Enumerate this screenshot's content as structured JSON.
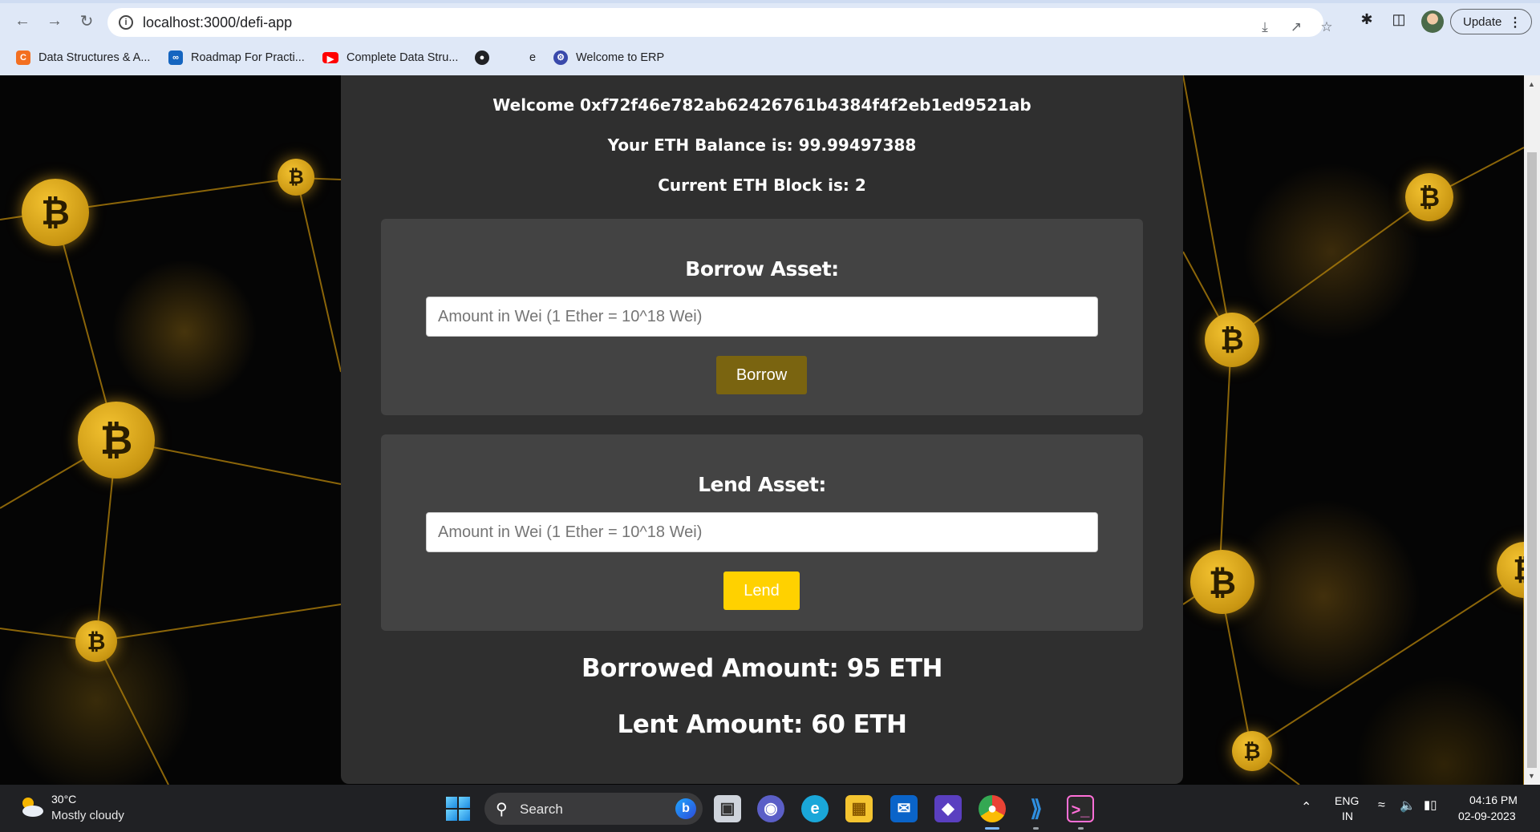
{
  "browser": {
    "url": "localhost:3000/defi-app",
    "update_label": "Update",
    "bookmarks": [
      {
        "label": "Data Structures & A...",
        "icon": "codechef-icon",
        "color": "#f36f21"
      },
      {
        "label": "Roadmap For Practi...",
        "icon": "infinity-icon",
        "color": "#1565c0"
      },
      {
        "label": "Complete Data Stru...",
        "icon": "youtube-icon",
        "color": "#ff0000"
      },
      {
        "label": "",
        "icon": "globe-icon",
        "color": "#202124"
      },
      {
        "label": "e",
        "icon": "",
        "color": ""
      },
      {
        "label": "Welcome to ERP",
        "icon": "erp-icon",
        "color": "#3949ab"
      }
    ]
  },
  "app": {
    "welcome": "Welcome 0xf72f46e782ab62426761b4384f4f2eb1ed9521ab",
    "balance": "Your ETH Balance is: 99.99497388",
    "block": "Current ETH Block is: 2",
    "borrow": {
      "title": "Borrow Asset:",
      "placeholder": "Amount in Wei (1 Ether = 10^18 Wei)",
      "button_label": "Borrow",
      "button_color": "#7a6410"
    },
    "lend": {
      "title": "Lend Asset:",
      "placeholder": "Amount in Wei (1 Ether = 10^18 Wei)",
      "button_label": "Lend",
      "button_color": "#ffd100"
    },
    "borrowed_amount": "Borrowed Amount: 95 ETH",
    "lent_amount": "Lent Amount: 60 ETH"
  },
  "taskbar": {
    "weather_temp": "30°C",
    "weather_desc": "Mostly cloudy",
    "search_label": "Search",
    "lang_top": "ENG",
    "lang_bottom": "IN",
    "time": "04:16 PM",
    "date": "02-09-2023"
  }
}
